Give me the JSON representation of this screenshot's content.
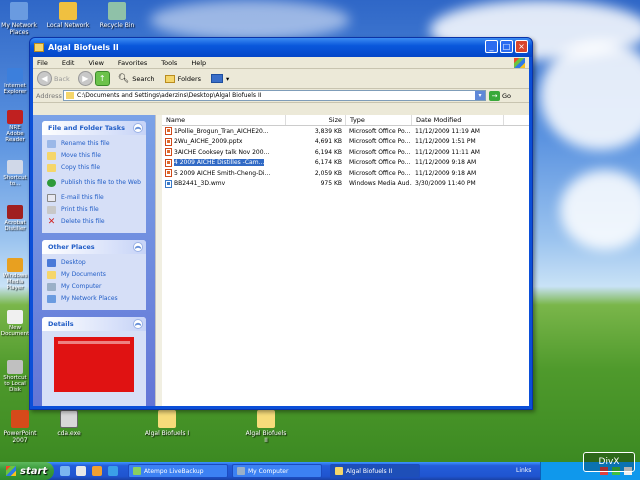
{
  "desktop": {
    "icons_top": [
      "My Network Places",
      "Local Network",
      "Recycle Bin"
    ],
    "icons_left": [
      "Internet Explorer",
      "NRE Adobe Reader",
      "Shortcut to...",
      "Acrobat Distiller",
      "Windows Media Player",
      "Acrobat",
      "New Document",
      "Shortcut to Local Disk"
    ],
    "icons_bottom": [
      "PowerPoint 2007",
      "cda.exe",
      "Algal Biofuels I",
      "Algal Biofuels II"
    ],
    "watermark": "DivX"
  },
  "window": {
    "title": "Algal Biofuels II",
    "menu": [
      "File",
      "Edit",
      "View",
      "Favorites",
      "Tools",
      "Help"
    ],
    "toolbar": {
      "back": "Back",
      "search": "Search",
      "folders": "Folders"
    },
    "address": {
      "label": "Address",
      "value": "C:\\Documents and Settings\\aderzins\\Desktop\\Algal Biofuels II",
      "go": "Go"
    }
  },
  "taskpane": {
    "file_tasks": {
      "title": "File and Folder Tasks",
      "items": [
        "Rename this file",
        "Move this file",
        "Copy this file",
        "Publish this file to the Web",
        "E-mail this file",
        "Print this file",
        "Delete this file"
      ]
    },
    "other_places": {
      "title": "Other Places",
      "items": [
        "Desktop",
        "My Documents",
        "My Computer",
        "My Network Places"
      ]
    },
    "details": {
      "title": "Details"
    }
  },
  "files": {
    "columns": [
      "Name",
      "Size",
      "Type",
      "Date Modified"
    ],
    "rows": [
      {
        "name": "1Pollie_Brogun_Tran_AICHE20...",
        "size": "3,839 KB",
        "type": "Microsoft Office Po...",
        "date": "11/12/2009 11:19 AM",
        "icon": "ppt-icon"
      },
      {
        "name": "2Wu_AICHE_2009.pptx",
        "size": "4,691 KB",
        "type": "Microsoft Office Po...",
        "date": "11/12/2009 1:51 PM",
        "icon": "ppt-icon"
      },
      {
        "name": "3AICHE Cooksey talk Nov 200...",
        "size": "6,194 KB",
        "type": "Microsoft Office Po...",
        "date": "11/12/2009 11:11 AM",
        "icon": "ppt-icon"
      },
      {
        "name": "4 2009 AICHE Distilles -Cam...",
        "size": "6,174 KB",
        "type": "Microsoft Office Po...",
        "date": "11/12/2009 9:18 AM",
        "icon": "ppt-icon",
        "selected": true
      },
      {
        "name": "5 2009 AICHE Smith-Cheng-Di...",
        "size": "2,059 KB",
        "type": "Microsoft Office Po...",
        "date": "11/12/2009 9:18 AM",
        "icon": "ppt-icon"
      },
      {
        "name": "BB2441_3D.wmv",
        "size": "975 KB",
        "type": "Windows Media Aud...",
        "date": "3/30/2009 11:40 PM",
        "icon": "wmv-icon"
      }
    ]
  },
  "taskbar": {
    "start": "start",
    "items": [
      "Atempo LiveBackup",
      "My Computer",
      "Algal Biofuels II"
    ],
    "links": "Links"
  }
}
